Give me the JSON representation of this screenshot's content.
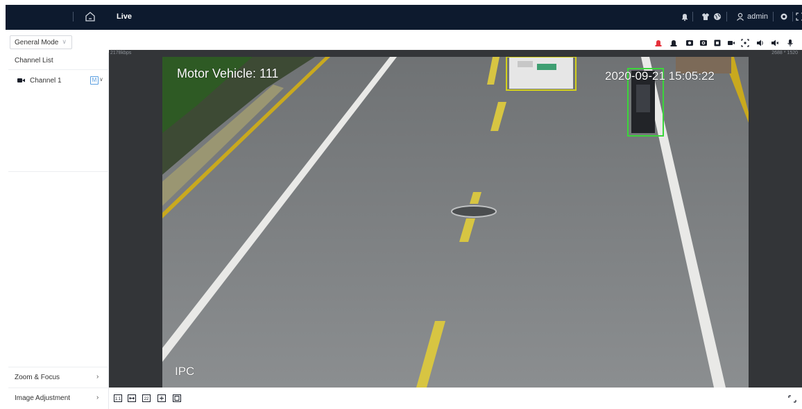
{
  "header": {
    "live_label": "Live",
    "user_name": "admin"
  },
  "toolbar": {
    "mode_select": "General Mode",
    "icons": [
      "alarm-red-icon",
      "alarm-icon",
      "record-icon",
      "snapshot-icon",
      "photo-icon",
      "video-icon",
      "target-icon",
      "speaker-icon",
      "speaker2-icon",
      "mic-icon"
    ]
  },
  "sidebar": {
    "header": "Channel List",
    "channel_name": "Channel 1",
    "channel_badge": "M",
    "zoom_focus": "Zoom & Focus",
    "image_adjustment": "Image Adjustment"
  },
  "video": {
    "bitrate": "2178kbps",
    "resolution": "2688 * 1520",
    "osd_title": "Motor Vehicle: 111",
    "osd_time": "2020-09-21 15:05:22",
    "osd_label": "IPC"
  },
  "bottom_tools": [
    "1:1",
    "fit",
    "2x2",
    "window",
    "full"
  ],
  "colors": {
    "topbar": "#0d1a2e",
    "accent": "#5a9ee0",
    "alarm": "#e5313b",
    "vehicle_box": "#d4d11c",
    "moto_box": "#3bd53b"
  }
}
